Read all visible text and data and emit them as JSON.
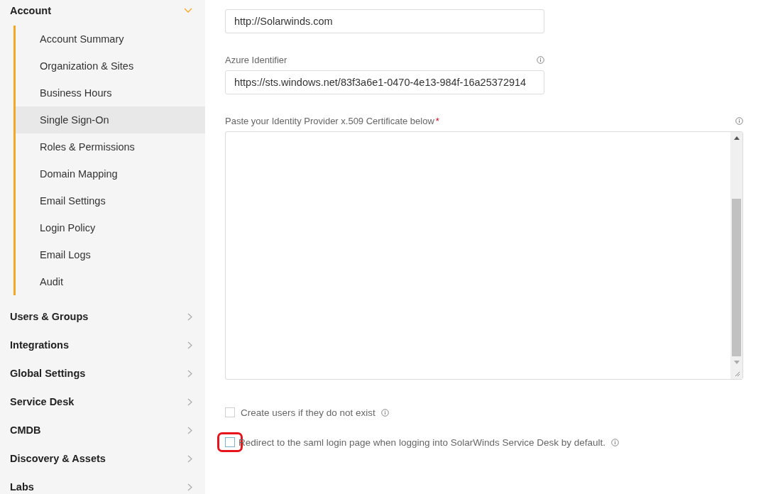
{
  "sidebar": {
    "sections": [
      {
        "label": "Account",
        "expanded": true,
        "children": [
          {
            "label": "Account Summary",
            "selected": false
          },
          {
            "label": "Organization & Sites",
            "selected": false
          },
          {
            "label": "Business Hours",
            "selected": false
          },
          {
            "label": "Single Sign-On",
            "selected": true
          },
          {
            "label": "Roles & Permissions",
            "selected": false
          },
          {
            "label": "Domain Mapping",
            "selected": false
          },
          {
            "label": "Email Settings",
            "selected": false
          },
          {
            "label": "Login Policy",
            "selected": false
          },
          {
            "label": "Email Logs",
            "selected": false
          },
          {
            "label": "Audit",
            "selected": false
          }
        ]
      },
      {
        "label": "Users & Groups",
        "expanded": false
      },
      {
        "label": "Integrations",
        "expanded": false
      },
      {
        "label": "Global Settings",
        "expanded": false
      },
      {
        "label": "Service Desk",
        "expanded": false
      },
      {
        "label": "CMDB",
        "expanded": false
      },
      {
        "label": "Discovery & Assets",
        "expanded": false
      },
      {
        "label": "Labs",
        "expanded": false
      }
    ]
  },
  "form": {
    "top_field": {
      "value": "http://Solarwinds.com"
    },
    "azure_identifier": {
      "label": "Azure Identifier",
      "value": "https://sts.windows.net/83f3a6e1-0470-4e13-984f-16a25372914"
    },
    "certificate": {
      "label": "Paste your Identity Provider x.509 Certificate below",
      "required_mark": "*"
    },
    "checkboxes": [
      {
        "label": "Create users if they do not exist",
        "checked": false,
        "highlighted": false
      },
      {
        "label": "Redirect to the saml login page when logging into SolarWinds Service Desk by default.",
        "checked": false,
        "highlighted": true
      }
    ]
  }
}
